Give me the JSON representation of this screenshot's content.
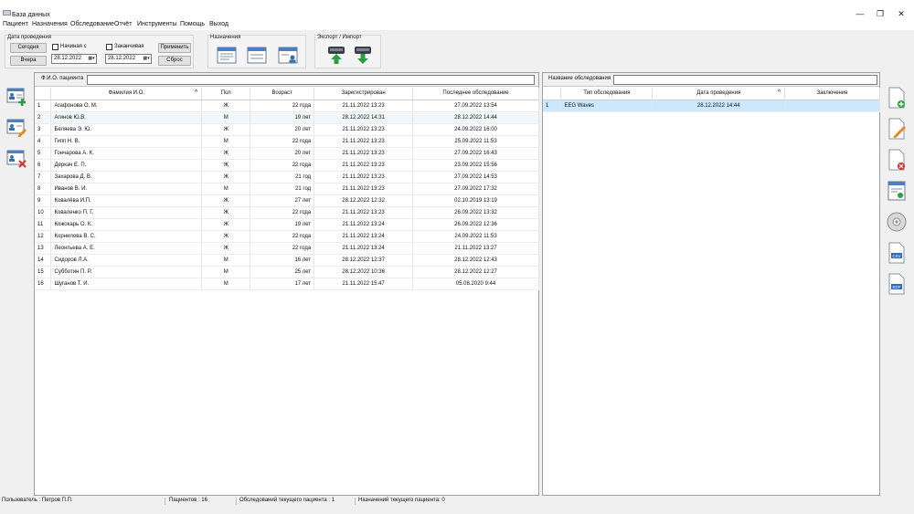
{
  "window": {
    "title": "База данных",
    "minimize": "—",
    "restore": "❐",
    "close": "✕"
  },
  "menu": [
    "Пациент",
    "Назначения",
    "Обследование",
    "Отчёт",
    "Инструменты",
    "Помощь",
    "Выход"
  ],
  "toolbar": {
    "date_group_title": "Дата проведения",
    "today_btn": "Сегодня",
    "yesterday_btn": "Вчера",
    "start_label": "Начиная с",
    "end_label": "Заканчивая",
    "start_date": "28.12.2022",
    "end_date": "28.12.2022",
    "apply_btn": "Применить",
    "reset_btn": "Сброс",
    "assign_group_title": "Назначения",
    "export_group_title": "Экспорт / Импорт"
  },
  "patients": {
    "filter_label": "Ф.И.О. пациента",
    "filter_value": "",
    "columns": [
      "",
      "Фамилия И.О.",
      "Пол",
      "Возраст",
      "Зарегистрирован",
      "Последнее обследование"
    ],
    "rows": [
      [
        "1",
        "Агафонова О. М.",
        "Ж",
        "22 года",
        "21.11.2022 13:23",
        "27.09.2022 13:54"
      ],
      [
        "2",
        "Агинов Ю.В.",
        "М",
        "19 лет",
        "28.12.2022 14:31",
        "28.12.2022 14:44"
      ],
      [
        "3",
        "Беляева Э. Ю.",
        "Ж",
        "20 лет",
        "21.11.2022 13:23",
        "24.09.2022 16:00"
      ],
      [
        "4",
        "Гипп Н. В.",
        "М",
        "22 года",
        "21.11.2022 13:23",
        "25.09.2022 11:53"
      ],
      [
        "5",
        "Гончарова А. К.",
        "Ж",
        "20 лет",
        "21.11.2022 13:23",
        "27.09.2022 16:43"
      ],
      [
        "6",
        "Деркач Е. П.",
        "Ж",
        "22 года",
        "21.11.2022 13:23",
        "23.09.2022 15:56"
      ],
      [
        "7",
        "Захарова Д. В.",
        "Ж",
        "21 год",
        "21.11.2022 13:23",
        "27.09.2022 14:53"
      ],
      [
        "8",
        "Иванов В. И.",
        "М",
        "21 год",
        "21.11.2022 13:23",
        "27.09.2022 17:32"
      ],
      [
        "9",
        "Ковалёва И.П.",
        "Ж",
        "27 лет",
        "28.12.2022 12:32",
        "02.10.2019 13:19"
      ],
      [
        "10",
        "Коваленко П. Г.",
        "Ж",
        "22 года",
        "21.11.2022 13:23",
        "26.09.2022 13:32"
      ],
      [
        "11",
        "Кожокарь О. К.",
        "Ж",
        "19 лет",
        "21.11.2022 13:24",
        "26.09.2022 12:36"
      ],
      [
        "12",
        "Корнилова В. С.",
        "Ж",
        "22 года",
        "21.11.2022 13:24",
        "24.09.2022 11:53"
      ],
      [
        "13",
        "Леонтьева А. Е.",
        "Ж",
        "22 года",
        "21.11.2022 13:24",
        "21.11.2022 13:27"
      ],
      [
        "14",
        "Сидоров Л.А.",
        "М",
        "16 лет",
        "28.12.2022 12:37",
        "28.12.2022 12:43"
      ],
      [
        "15",
        "Субботин П. Р.",
        "М",
        "25 лет",
        "28.12.2022 10:36",
        "28.12.2022 12:27"
      ],
      [
        "16",
        "Шуганов Т. И.",
        "М",
        "17 лет",
        "21.11.2022 15:47",
        "05.08.2020 9:44"
      ]
    ]
  },
  "exams": {
    "filter_label": "Название обследования",
    "filter_value": "",
    "columns": [
      "",
      "Тип обследования",
      "Дата проведения",
      "Заключение"
    ],
    "rows": [
      [
        "1",
        "EEG Waves",
        "28.12.2022 14:44",
        ""
      ]
    ]
  },
  "status": {
    "user": "Пользователь : Петров П.П.",
    "patients": "Пациентов : 16",
    "exams": "Обследований текущего пациента : 1",
    "assignments": "Назначений  текущего пациента: 0"
  },
  "icons": {
    "left": [
      "add-patient-icon",
      "edit-patient-icon",
      "delete-patient-icon"
    ],
    "right": [
      "add-exam-icon",
      "edit-exam-icon",
      "delete-exam-icon",
      "exam-report-icon",
      "disc-icon",
      "export-csv-icon",
      "export-edf-icon"
    ],
    "right_labels": {
      "csv": "CSV",
      "edf": "EDF"
    }
  },
  "colors": {
    "selected_row": "#cce8ff",
    "accent_green": "#2e9e3e",
    "accent_red": "#d23030"
  }
}
